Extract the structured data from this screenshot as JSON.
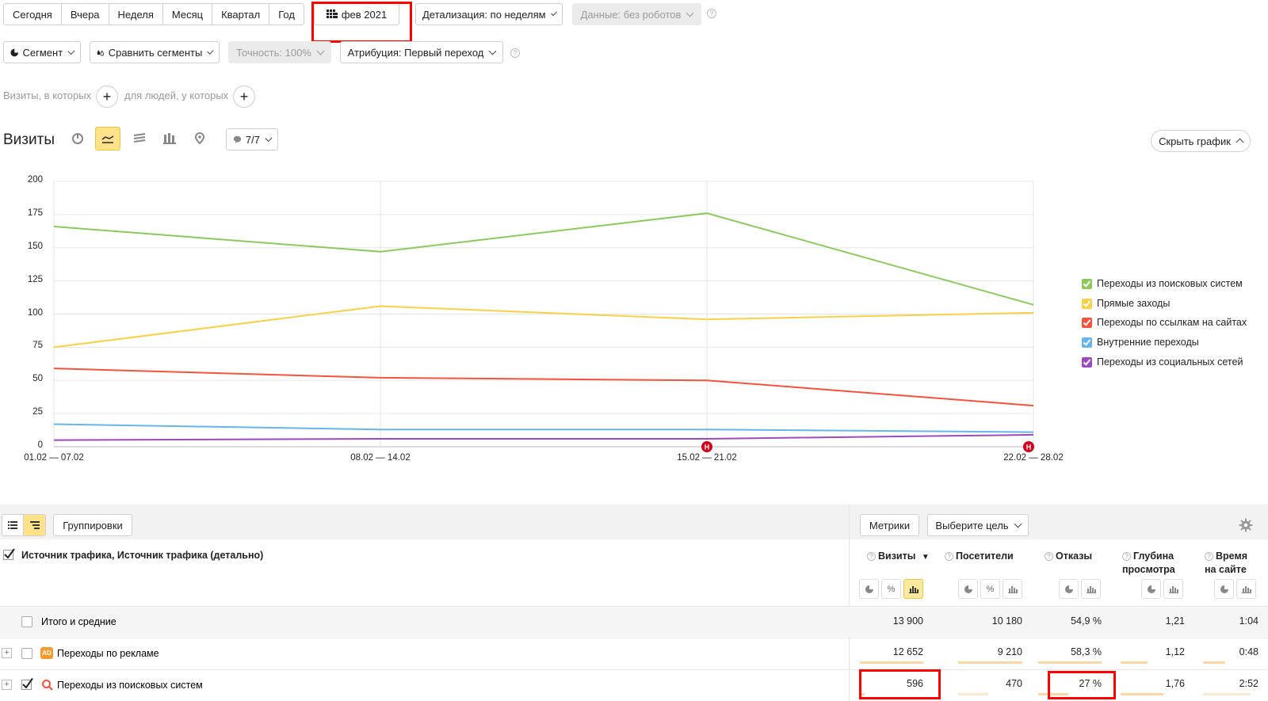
{
  "period_presets": [
    "Сегодня",
    "Вчера",
    "Неделя",
    "Месяц",
    "Квартал",
    "Год"
  ],
  "date_picker": {
    "label": "фев 2021"
  },
  "detail_dropdown": {
    "label": "Детализация: по неделям"
  },
  "data_filter": {
    "label": "Данные: без роботов"
  },
  "segment": {
    "label": "Сегмент"
  },
  "compare_segments": {
    "label": "Сравнить сегменты"
  },
  "accuracy": {
    "label": "Точность: 100%"
  },
  "attribution": {
    "label": "Атрибуция: Первый переход"
  },
  "filters": {
    "visits_label": "Визиты, в которых",
    "people_label": "для людей, у которых"
  },
  "report": {
    "title": "Визиты",
    "series_toggle": "7/7",
    "hide_chart": "Скрыть график"
  },
  "colors": {
    "green": "#8bc95c",
    "yellow": "#f9d148",
    "red": "#f4533d",
    "blue": "#68b5ee",
    "purple": "#9c4bbf",
    "highlight": "#ff0000"
  },
  "chart_data": {
    "type": "line",
    "x": [
      "01.02 — 07.02",
      "08.02 — 14.02",
      "15.02 — 21.02",
      "22.02 — 28.02"
    ],
    "ylim": [
      0,
      200
    ],
    "yticks": [
      0,
      25,
      50,
      75,
      100,
      125,
      150,
      175,
      200
    ],
    "grid": true,
    "legend_position": "right",
    "annotations": [
      "Н",
      "Н"
    ],
    "series": [
      {
        "name": "Переходы из поисковых систем",
        "color": "#8bc95c",
        "values": [
          166,
          147,
          176,
          107
        ]
      },
      {
        "name": "Прямые заходы",
        "color": "#f9d148",
        "values": [
          75,
          106,
          96,
          101
        ]
      },
      {
        "name": "Переходы по ссылкам на сайтах",
        "color": "#f4533d",
        "values": [
          59,
          52,
          50,
          31
        ]
      },
      {
        "name": "Внутренние переходы",
        "color": "#68b5ee",
        "values": [
          17,
          13,
          13,
          11
        ]
      },
      {
        "name": "Переходы из социальных сетей",
        "color": "#9c4bbf",
        "values": [
          5,
          6,
          6,
          9
        ]
      }
    ]
  },
  "table_toolbar": {
    "groupings": "Группировки",
    "metrics": "Метрики",
    "goal": "Выберите цель"
  },
  "table": {
    "dimension_header": "Источник трафика, Источник трафика (детально)",
    "columns": [
      {
        "line1": "Визиты",
        "line2": "",
        "sorted": "▼"
      },
      {
        "line1": "Посетители",
        "line2": ""
      },
      {
        "line1": "Отказы",
        "line2": ""
      },
      {
        "line1": "Глубина",
        "line2": "просмотра"
      },
      {
        "line1": "Время",
        "line2": "на сайте"
      }
    ],
    "rows": [
      {
        "label": "Итого и средние",
        "values": [
          "13 900",
          "10 180",
          "54,9 %",
          "1,21",
          "1:04"
        ]
      },
      {
        "label": "Переходы по рекламе",
        "badge": "AD",
        "values": [
          "12 652",
          "9 210",
          "58,3 %",
          "1,12",
          "0:48"
        ]
      },
      {
        "label": "Переходы из поисковых систем",
        "values": [
          "596",
          "470",
          "27 %",
          "1,76",
          "2:52"
        ]
      }
    ]
  }
}
